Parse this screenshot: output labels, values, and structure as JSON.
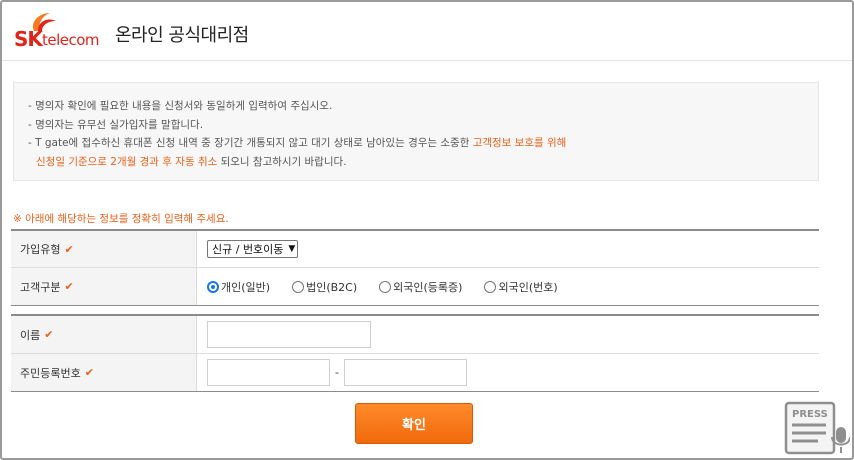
{
  "header": {
    "logo_sk": "SK",
    "logo_telecom": "telecom",
    "title": "온라인 공식대리점"
  },
  "notice": {
    "line1": "- 명의자 확인에 필요한 내용을 신청서와 동일하게 입력하여 주십시오.",
    "line2": "- 명의자는 유무선 실가입자를 말합니다.",
    "line3_prefix": "- T gate에 접수하신 휴대폰 신청 내역 중 장기간 개통되지 않고 대기 상태로 남아있는 경우는 소중한 ",
    "line3_highlight": "고객정보 보호를 위해",
    "line4_highlight": "신청일 기준으로 2개월 경과 후 자동 취소",
    "line4_suffix": " 되오니 참고하시기 바랍니다."
  },
  "warning": "※ 아래에 해당하는 정보를 정확히 입력해 주세요.",
  "form": {
    "join_type_label": "가입유형",
    "join_type_value": "신규 / 번호이동",
    "customer_type_label": "고객구분",
    "customer_options": [
      "개인(일반)",
      "법인(B2C)",
      "외국인(등록증)",
      "외국인(번호)"
    ],
    "customer_selected": 0,
    "name_label": "이름",
    "ssn_label": "주민등록번호",
    "ssn_separator": "-"
  },
  "confirm_button": "확인",
  "badge_text": "PRESS",
  "colors": {
    "brand_red": "#e2231a",
    "accent_orange": "#e8621a",
    "check_orange": "#e8621a"
  }
}
